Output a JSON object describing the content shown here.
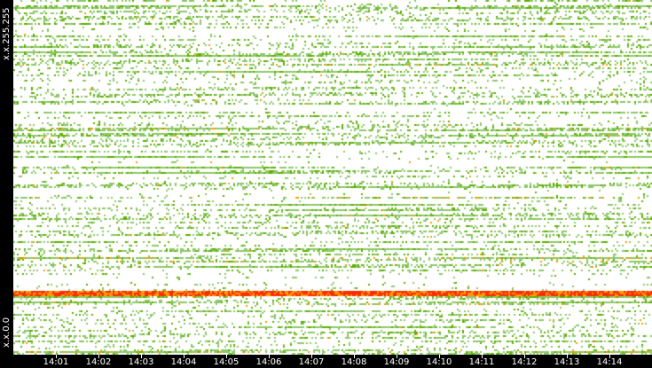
{
  "chart_data": {
    "type": "heatmap",
    "title": "",
    "y_labels": {
      "top": "x.x.255.255",
      "bottom": "x.x.0.0"
    },
    "x_ticks": [
      "14:01",
      "14:02",
      "14:03",
      "14:04",
      "14:05",
      "14:06",
      "14:07",
      "14:08",
      "14:09",
      "14:10",
      "14:11",
      "14:12",
      "14:13",
      "14:14"
    ],
    "colors": {
      "low": "#8dc86a",
      "mid": "#5fb000",
      "high": "#ff9900",
      "max": "#ff2a00",
      "empty": "#ffffff",
      "background": "#000000"
    }
  }
}
